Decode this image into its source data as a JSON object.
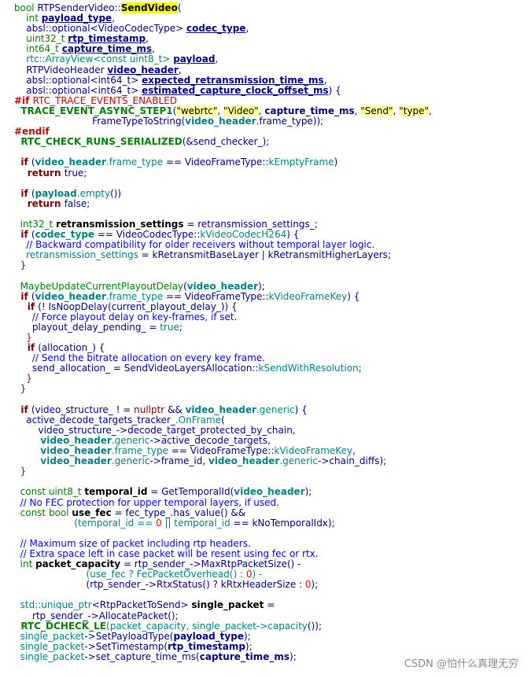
{
  "watermark": "CSDN @怕什么真理无穷",
  "lines": [
    [
      [
        "t",
        "bool "
      ],
      [
        "n",
        "RTPSenderVideo::"
      ],
      [
        "hl",
        "SendVideo"
      ],
      [
        "n",
        "("
      ]
    ],
    [
      [
        "t",
        "    int "
      ],
      [
        "nbu",
        "payload_type"
      ],
      [
        "n",
        ","
      ]
    ],
    [
      [
        "n",
        "    absl::optional<VideoCodecType> "
      ],
      [
        "nbu",
        "codec_type"
      ],
      [
        "n",
        ","
      ]
    ],
    [
      [
        "t",
        "    uint32_t "
      ],
      [
        "nbu",
        "rtp_timestamp"
      ],
      [
        "n",
        ","
      ]
    ],
    [
      [
        "t",
        "    int64_t "
      ],
      [
        "nbu",
        "capture_time_ms"
      ],
      [
        "n",
        ","
      ]
    ],
    [
      [
        "m",
        "    rtc::ArrayView<const uint8_t> "
      ],
      [
        "nbu",
        "payload"
      ],
      [
        "n",
        ","
      ]
    ],
    [
      [
        "n",
        "    RTPVideoHeader "
      ],
      [
        "nbu",
        "video_header"
      ],
      [
        "n",
        ","
      ]
    ],
    [
      [
        "n",
        "    absl::optional<int64_t> "
      ],
      [
        "nbu",
        "expected_retransmission_time_ms"
      ],
      [
        "n",
        ","
      ]
    ],
    [
      [
        "n",
        "    absl::optional<int64_t> "
      ],
      [
        "nbu",
        "estimated_capture_clock_offset_ms"
      ],
      [
        "n",
        ") {"
      ]
    ],
    [
      [
        "pre",
        "#if "
      ],
      [
        "prt",
        "RTC_TRACE_EVENTS_ENABLED"
      ]
    ],
    [
      [
        "mac",
        "  TRACE_EVENT_ASYNC_STEP1"
      ],
      [
        "n",
        "("
      ],
      [
        "str",
        "\"webrtc\""
      ],
      [
        "n",
        ", "
      ],
      [
        "str",
        "\"Video\""
      ],
      [
        "n",
        ", "
      ],
      [
        "nb",
        "capture_time_ms"
      ],
      [
        "n",
        ", "
      ],
      [
        "str",
        "\"Send\""
      ],
      [
        "n",
        ", "
      ],
      [
        "str",
        "\"type\""
      ],
      [
        "n",
        ","
      ]
    ],
    [
      [
        "n",
        "                          FrameTypeToString("
      ],
      [
        "mb",
        "video_header"
      ],
      [
        "n",
        ".frame_type));"
      ]
    ],
    [
      [
        "pre",
        "#endif"
      ]
    ],
    [
      [
        "mac",
        "  RTC_CHECK_RUNS_SERIALIZED"
      ],
      [
        "n",
        "(&send_checker_);"
      ]
    ],
    "blank",
    [
      [
        "kb",
        "  if "
      ],
      [
        "n",
        "("
      ],
      [
        "mb",
        "video_header"
      ],
      [
        "m",
        ".frame_type"
      ],
      [
        "n",
        " == VideoFrameType::"
      ],
      [
        "m",
        "kEmptyFrame"
      ],
      [
        "n",
        ")"
      ]
    ],
    [
      [
        "kb",
        "    return "
      ],
      [
        "n",
        "true;"
      ]
    ],
    "blank",
    [
      [
        "kb",
        "  if "
      ],
      [
        "n",
        "("
      ],
      [
        "mb",
        "payload"
      ],
      [
        "m",
        ".empty"
      ],
      [
        "n",
        "())"
      ]
    ],
    [
      [
        "kb",
        "    return "
      ],
      [
        "n",
        "false;"
      ]
    ],
    "blank",
    [
      [
        "t",
        "  int32_t "
      ],
      [
        "bl",
        "retransmission_settings"
      ],
      [
        "n",
        " = retransmission_settings_;"
      ]
    ],
    [
      [
        "kb",
        "  if "
      ],
      [
        "n",
        "("
      ],
      [
        "mb",
        "codec_type"
      ],
      [
        "n",
        " == VideoCodecType::"
      ],
      [
        "m",
        "kVideoCodecH264"
      ],
      [
        "n",
        ") {"
      ]
    ],
    [
      [
        "c",
        "    // Backward compatibility for older receivers without temporal layer logic."
      ]
    ],
    [
      [
        "m",
        "    retransmission_settings"
      ],
      [
        "n",
        " = kRetransmitBaseLayer | kRetransmitHigherLayers;"
      ]
    ],
    [
      [
        "p",
        "  }"
      ]
    ],
    "blank",
    [
      [
        "t",
        "  MaybeUpdateCurrentPlayoutDelay"
      ],
      [
        "n",
        "("
      ],
      [
        "mb",
        "video_header"
      ],
      [
        "n",
        ");"
      ]
    ],
    [
      [
        "kb",
        "  if "
      ],
      [
        "n",
        "("
      ],
      [
        "mb",
        "video_header"
      ],
      [
        "m",
        ".frame_type"
      ],
      [
        "n",
        " == VideoFrameType::"
      ],
      [
        "m",
        "kVideoFrameKey"
      ],
      [
        "n",
        ") {"
      ]
    ],
    [
      [
        "kb",
        "    if "
      ],
      [
        "n",
        "(! IsNoopDelay(current_playout_delay_)) {"
      ]
    ],
    [
      [
        "c",
        "      // Force playout delay on key-frames, if set."
      ]
    ],
    [
      [
        "n",
        "      playout_delay_pending_ = "
      ],
      [
        "m",
        "true"
      ],
      [
        "n",
        ";"
      ]
    ],
    [
      [
        "p",
        "    }"
      ]
    ],
    [
      [
        "kb",
        "    if "
      ],
      [
        "n",
        "(allocation_) {"
      ]
    ],
    [
      [
        "c",
        "      // Send the bitrate allocation on every key frame."
      ]
    ],
    [
      [
        "n",
        "      send_allocation_ = SendVideoLayersAllocation::"
      ],
      [
        "m",
        "kSendWithResolution"
      ],
      [
        "n",
        ";"
      ]
    ],
    [
      [
        "p",
        "    }"
      ]
    ],
    [
      [
        "p",
        "  }"
      ]
    ],
    "blank",
    [
      [
        "kb",
        "  if "
      ],
      [
        "n",
        "(video_structure_ ! = "
      ],
      [
        "k",
        "nullptr"
      ],
      [
        "n",
        " && "
      ],
      [
        "mb",
        "video_header"
      ],
      [
        "m",
        ".generic"
      ],
      [
        "n",
        ") {"
      ]
    ],
    [
      [
        "n",
        "    active_decode_targets_tracker_"
      ],
      [
        "m",
        ".OnFrame"
      ],
      [
        "n",
        "("
      ]
    ],
    [
      [
        "n",
        "        video_structure_->decode_target_protected_by_chain,"
      ]
    ],
    [
      [
        "mb",
        "        video_header"
      ],
      [
        "m",
        ".generic"
      ],
      [
        "n",
        "->active_decode_targets,"
      ]
    ],
    [
      [
        "mb",
        "        video_header"
      ],
      [
        "m",
        ".frame_type"
      ],
      [
        "n",
        " == VideoFrameType::"
      ],
      [
        "m",
        "kVideoFrameKey"
      ],
      [
        "n",
        ","
      ]
    ],
    [
      [
        "mb",
        "        video_header"
      ],
      [
        "m",
        ".generic"
      ],
      [
        "n",
        "->frame_id, "
      ],
      [
        "mb",
        "video_header"
      ],
      [
        "m",
        ".generic"
      ],
      [
        "n",
        "->chain_diffs);"
      ]
    ],
    [
      [
        "p",
        "  }"
      ]
    ],
    "blank",
    [
      [
        "t",
        "  const uint8_t "
      ],
      [
        "bl",
        "temporal_id"
      ],
      [
        "n",
        " = GetTemporalId("
      ],
      [
        "mb",
        "video_header"
      ],
      [
        "n",
        ");"
      ]
    ],
    [
      [
        "c",
        "  // No FEC protection for upper temporal layers, if used."
      ]
    ],
    [
      [
        "t",
        "  const bool "
      ],
      [
        "bl",
        "use_fec"
      ],
      [
        "n",
        " = fec_type_.has_value() &&"
      ]
    ],
    [
      [
        "m",
        "                    (temporal_id == "
      ],
      [
        "num",
        "0"
      ],
      [
        "m",
        " || temporal_id"
      ],
      [
        "n",
        " == kNoTemporalIdx);"
      ]
    ],
    "blank",
    [
      [
        "c",
        "  // Maximum size of packet including rtp headers."
      ]
    ],
    [
      [
        "c",
        "  // Extra space left in case packet will be resent using fec or rtx."
      ]
    ],
    [
      [
        "t",
        "  int "
      ],
      [
        "bl",
        "packet_capacity"
      ],
      [
        "n",
        " = rtp_sender_->MaxRtpPacketSize() -"
      ]
    ],
    [
      [
        "m",
        "                        (use_fec ? FecPacketOverhead() : "
      ],
      [
        "num",
        "0"
      ],
      [
        "m",
        ") -"
      ]
    ],
    [
      [
        "n",
        "                        (rtp_sender_->RtxStatus() ? kRtxHeaderSize : "
      ],
      [
        "num",
        "0"
      ],
      [
        "n",
        ");"
      ]
    ],
    "blank",
    [
      [
        "m",
        "  std::unique_ptr"
      ],
      [
        "n",
        "<RtpPacketToSend> "
      ],
      [
        "bl",
        "single_packet"
      ],
      [
        "n",
        " ="
      ]
    ],
    [
      [
        "n",
        "      rtp_sender_->AllocatePacket();"
      ]
    ],
    [
      [
        "mac",
        "  RTC_DCHECK_LE"
      ],
      [
        "m",
        "(packet_capacity, single_packet->capacity"
      ],
      [
        "n",
        "());"
      ]
    ],
    [
      [
        "m",
        "  single_packet"
      ],
      [
        "n",
        "->SetPayloadType("
      ],
      [
        "nb",
        "payload_type"
      ],
      [
        "n",
        ");"
      ]
    ],
    [
      [
        "m",
        "  single_packet"
      ],
      [
        "n",
        "->SetTimestamp("
      ],
      [
        "nb",
        "rtp_timestamp"
      ],
      [
        "n",
        ");"
      ]
    ],
    [
      [
        "m",
        "  single_packet"
      ],
      [
        "n",
        "->set_capture_time_ms("
      ],
      [
        "nb",
        "capture_time_ms"
      ],
      [
        "n",
        ");"
      ]
    ]
  ]
}
